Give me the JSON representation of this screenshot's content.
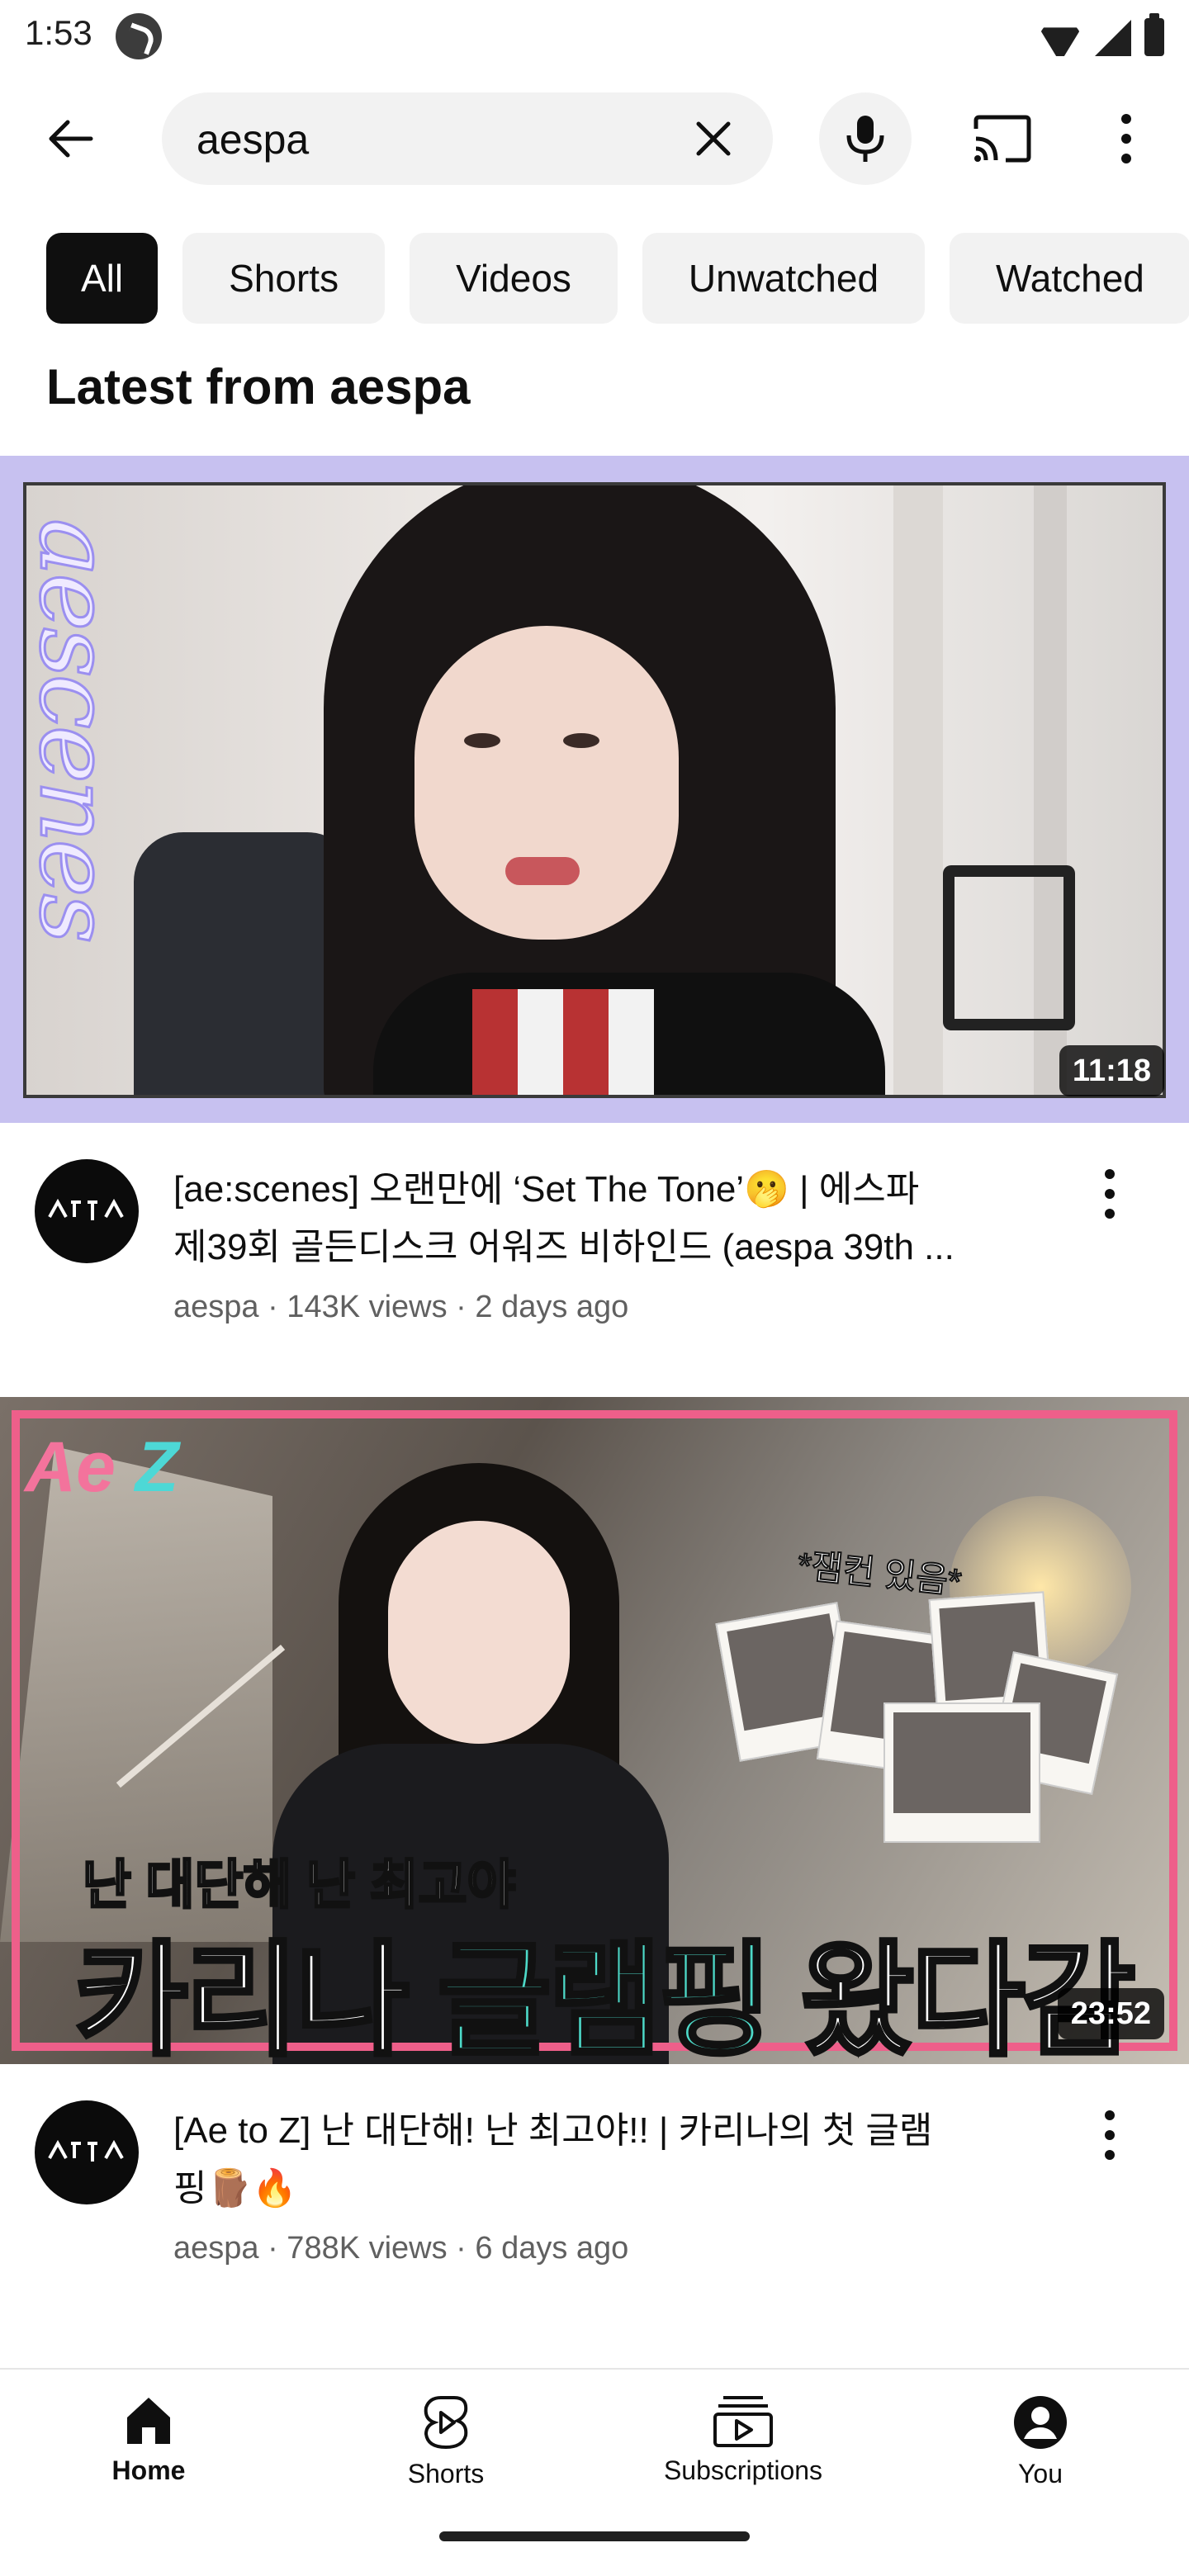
{
  "status_bar": {
    "time": "1:53"
  },
  "search": {
    "query": "aespa",
    "icons": {
      "back": "arrow-left",
      "clear": "close-x",
      "voice": "microphone",
      "cast": "cast",
      "more": "more-vertical"
    }
  },
  "chips": [
    {
      "label": "All",
      "active": true
    },
    {
      "label": "Shorts",
      "active": false
    },
    {
      "label": "Videos",
      "active": false
    },
    {
      "label": "Unwatched",
      "active": false
    },
    {
      "label": "Watched",
      "active": false
    }
  ],
  "section_title": "Latest from aespa",
  "videos": [
    {
      "title_line1": "[ae:scenes] 오랜만에 ‘Set The Tone’🫢 | 에스파",
      "title_line2": "제39회 골든디스크 어워즈 비하인드 (aespa 39th ...",
      "channel": "aespa",
      "views": "143K views",
      "age": "2 days ago",
      "meta": "aespa · 143K views · 2 days ago",
      "duration": "11:18",
      "thumbnail_side_text": "aescenes"
    },
    {
      "title_line1": "[Ae to Z] 난 대단해! 난 최고야!! | 카리나의 첫 글램",
      "title_line2": "핑🪵🔥",
      "channel": "aespa",
      "views": "788K views",
      "age": "6 days ago",
      "meta": "aespa · 788K views · 6 days ago",
      "duration": "23:52",
      "thumbnail_logo_a": "Ae",
      "thumbnail_logo_b": "Z",
      "thumbnail_note": "*잼컨 있음*",
      "thumbnail_subtitle": "난 대단해 난 최고야",
      "thumbnail_title_a": "카리나 ",
      "thumbnail_title_b": "글램핑",
      "thumbnail_title_c": " 왔다감"
    }
  ],
  "bottom_nav": [
    {
      "label": "Home",
      "icon": "home-icon",
      "active": true
    },
    {
      "label": "Shorts",
      "icon": "shorts-icon",
      "active": false
    },
    {
      "label": "Subscriptions",
      "icon": "subscriptions-icon",
      "active": false
    },
    {
      "label": "You",
      "icon": "profile-icon",
      "active": false
    }
  ],
  "colors": {
    "chip_active_bg": "#0f0f0f",
    "chip_bg": "#f2f2f2",
    "meta_text": "#606060",
    "thumb1_border": "#c7c1f0",
    "thumb2_frame": "#ee5f8a",
    "thumb2_accent": "#4dd9c8"
  }
}
